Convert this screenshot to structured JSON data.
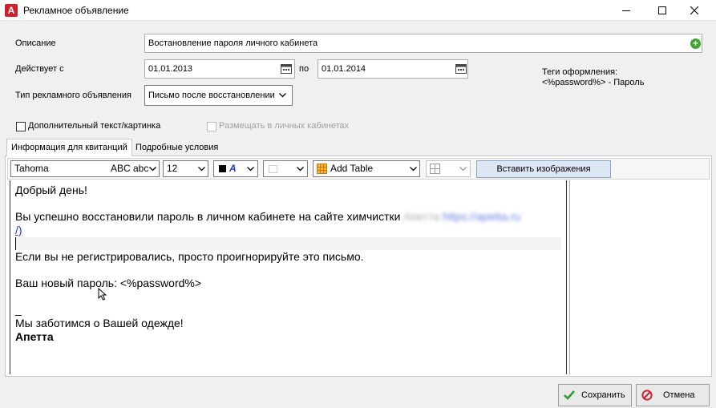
{
  "window": {
    "title": "Рекламное объявление",
    "app_icon_letter": "А",
    "controls": [
      "minimize-icon",
      "maximize-icon",
      "close-icon"
    ]
  },
  "form": {
    "description_label": "Описание",
    "description_value": "Востановление пароля личного кабинета",
    "valid_from_label": "Действует с",
    "valid_from_value": "01.01.2013",
    "valid_to_label": "по",
    "valid_to_value": "01.01.2014",
    "ad_type_label": "Тип рекламного объявления",
    "ad_type_value": "Письмо после восстановлении",
    "tags_title": "Теги оформления:",
    "tags_value": "<%password%> - Пароль",
    "extra_text_label": "Дополнительный текст/картинка",
    "extra_text_checked": false,
    "personal_cabinet_label": "Размещать в личных кабинетах",
    "personal_cabinet_checked": false,
    "personal_cabinet_enabled": false
  },
  "tabs": [
    {
      "label": "Информация для квитанций",
      "active": true
    },
    {
      "label": "Подробные условия",
      "active": false
    }
  ],
  "toolbar": {
    "font_name": "Tahoma",
    "font_preview": "ABC abc",
    "font_size": "12",
    "text_color_glyph": "A",
    "add_table_label": "Add Table",
    "insert_images_label": "Вставить изображения"
  },
  "editor": {
    "line1": "Добрый день!",
    "line2": "Вы успешно восстановили пароль в личном кабинете на сайте химчистки",
    "line2_blurred_name": "Апетта",
    "line2_blurred_link": "https://apetta.ru",
    "line3": "/)",
    "line4": "Если вы не регистрировались, просто проигнорируйте это письмо.",
    "line5": "Ваш новый пароль: <%password%>",
    "line6": "_",
    "line7": "Мы заботимся о Вашей одежде!",
    "line8": "Апетта"
  },
  "footer": {
    "save_label": "Сохранить",
    "cancel_label": "Отмена"
  },
  "colors": {
    "accent_red": "#d0202a",
    "add_green": "#3fa52f",
    "link_blue": "#1a35d8"
  }
}
